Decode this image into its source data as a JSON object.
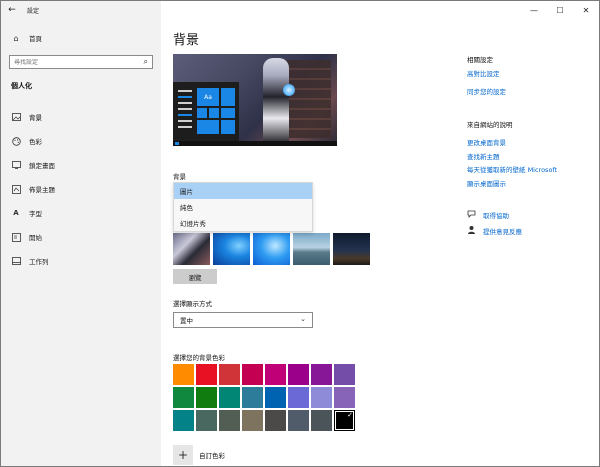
{
  "window": {
    "title": "設定",
    "controls": [
      "—",
      "☐",
      "✕"
    ]
  },
  "sidebar": {
    "back_glyph": "←",
    "home_label": "首頁",
    "search_placeholder": "尋找設定",
    "section_label": "個人化",
    "items": [
      {
        "label": "背景",
        "icon": "image-icon"
      },
      {
        "label": "色彩",
        "icon": "palette-icon"
      },
      {
        "label": "鎖定畫面",
        "icon": "lock-screen-icon"
      },
      {
        "label": "佈景主題",
        "icon": "theme-icon"
      },
      {
        "label": "字型",
        "icon": "font-icon"
      },
      {
        "label": "開始",
        "icon": "start-icon"
      },
      {
        "label": "工作列",
        "icon": "taskbar-icon"
      }
    ]
  },
  "main": {
    "title": "背景",
    "preview_tile_text": "Aa",
    "background_label": "背景",
    "background_options": [
      "圖片",
      "純色",
      "幻燈片秀"
    ],
    "background_selected": "圖片",
    "browse_label": "瀏覽",
    "fit_label": "選擇顯示方式",
    "fit_value": "置中",
    "color_label": "選擇您的背景色彩",
    "colors": [
      "#ff8c00",
      "#e81123",
      "#d13438",
      "#c30052",
      "#bf0077",
      "#9a0089",
      "#881798",
      "#744da9",
      "#10893e",
      "#107c10",
      "#018574",
      "#2d7d9a",
      "#0063b1",
      "#6b69d6",
      "#8e8cd8",
      "#8764b8",
      "#038387",
      "#486860",
      "#525e54",
      "#7e735f",
      "#4c4a48",
      "#515c6b",
      "#4a5459",
      "#000000"
    ],
    "selected_color": "#000000",
    "custom_color_label": "自訂色彩"
  },
  "right": {
    "related_heading": "相關設定",
    "related_links": [
      "高對比設定",
      "同步您的設定"
    ],
    "help_heading": "來自網站的說明",
    "help_links": [
      "更改桌面背景",
      "查找新主題",
      "每天從獲取新的壁紙 Microsoft",
      "顯示桌面圖示"
    ],
    "get_help": "取得協助",
    "feedback": "提供意見反應"
  }
}
